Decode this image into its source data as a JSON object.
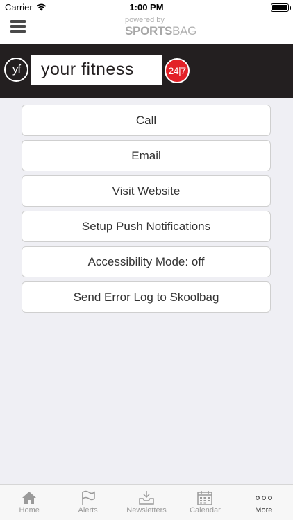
{
  "status_bar": {
    "carrier": "Carrier",
    "time": "1:00 PM"
  },
  "nav": {
    "powered_by": "powered by",
    "brand_bold": "SPORTS",
    "brand_light": "BAG"
  },
  "banner": {
    "logo_initials": "yf",
    "brand_name": "your fitness",
    "badge": "24|7",
    "background_color": "#231f20",
    "badge_color": "#e32128"
  },
  "menu": {
    "items": [
      {
        "label": "Call"
      },
      {
        "label": "Email"
      },
      {
        "label": "Visit Website"
      },
      {
        "label": "Setup Push Notifications"
      },
      {
        "label": "Accessibility Mode: off"
      },
      {
        "label": "Send Error Log to Skoolbag"
      }
    ]
  },
  "tab_bar": {
    "tabs": [
      {
        "label": "Home",
        "icon": "home-icon",
        "active": false
      },
      {
        "label": "Alerts",
        "icon": "flag-icon",
        "active": false
      },
      {
        "label": "Newsletters",
        "icon": "inbox-icon",
        "active": false
      },
      {
        "label": "Calendar",
        "icon": "calendar-icon",
        "active": false
      },
      {
        "label": "More",
        "icon": "more-icon",
        "active": true
      }
    ]
  }
}
